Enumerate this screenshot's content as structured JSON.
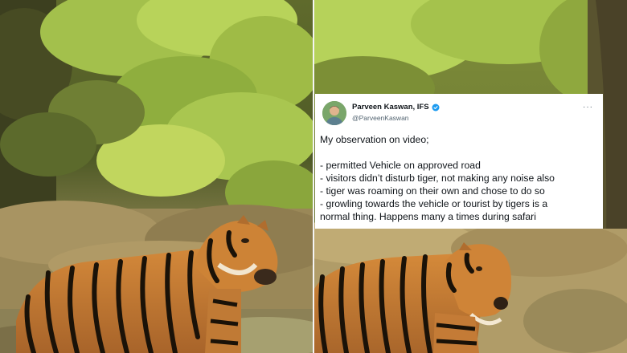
{
  "tweet": {
    "display_name": "Parveen Kaswan, IFS",
    "handle": "@ParveenKaswan",
    "avatar_icon": "person-avatar-icon",
    "verified_icon": "verified-badge-icon",
    "more_icon": "more-options-icon",
    "more_glyph": "···",
    "body": {
      "intro": "My observation on video;",
      "points": [
        "- permitted Vehicle on approved road",
        "- visitors didn’t disturb tiger, not making any noise also",
        "- tiger was roaming on their own and chose to do so",
        "- growling towards the vehicle or tourist by tigers is a",
        "normal thing. Happens many a times during safari"
      ]
    }
  },
  "colors": {
    "foliage": "#9bb84a",
    "grass": "#b7a36a",
    "tiger": "#c97a2f",
    "verified": "#1d9bf0"
  }
}
